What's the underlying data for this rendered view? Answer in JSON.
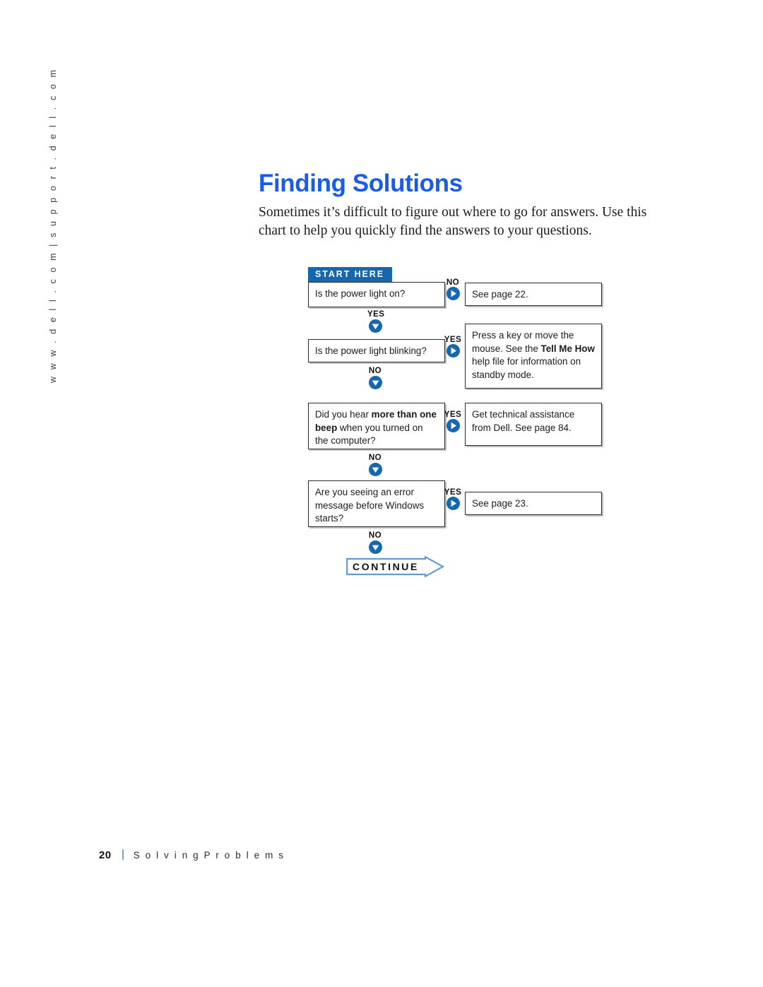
{
  "side_rail": {
    "text": "w w w . d e l l . c o m   |   s u p p o r t . d e l l . c o m"
  },
  "header": {
    "title": "Finding Solutions",
    "title_color": "#1a5ce8",
    "intro": "Sometimes it’s difficult to figure out where to go for answers. Use this chart to help you quickly find the answers to your questions."
  },
  "flowchart": {
    "type": "decision-flowchart",
    "start_label": "START HERE",
    "continue_label": "CONTINUE",
    "accent_color": "#1567b0",
    "continue_outline_color": "#6699cc",
    "rows": [
      {
        "question": "Is the power light on?",
        "branch_out_label": "NO",
        "branch_out_direction": "right",
        "answer": "See page 22.",
        "branch_down_label": "YES"
      },
      {
        "question": "Is the power light blinking?",
        "branch_out_label": "YES",
        "branch_out_direction": "right",
        "answer_part1": "Press a key or move the mouse. See the ",
        "answer_bold": "Tell Me How",
        "answer_part2": " help file for information on standby mode.",
        "branch_down_label": "NO"
      },
      {
        "question_part1": "Did you hear ",
        "question_bold": "more than one beep",
        "question_part2": " when you turned on the computer?",
        "branch_out_label": "YES",
        "branch_out_direction": "right",
        "answer": "Get technical assistance from Dell. See page 84.",
        "branch_down_label": "NO"
      },
      {
        "question": "Are you seeing an error message before Windows starts?",
        "branch_out_label": "YES",
        "branch_out_direction": "right",
        "answer": "See page 23.",
        "branch_down_label": "NO"
      }
    ]
  },
  "footer": {
    "page_number": "20",
    "section": "S o l v i n g   P r o b l e m s"
  }
}
